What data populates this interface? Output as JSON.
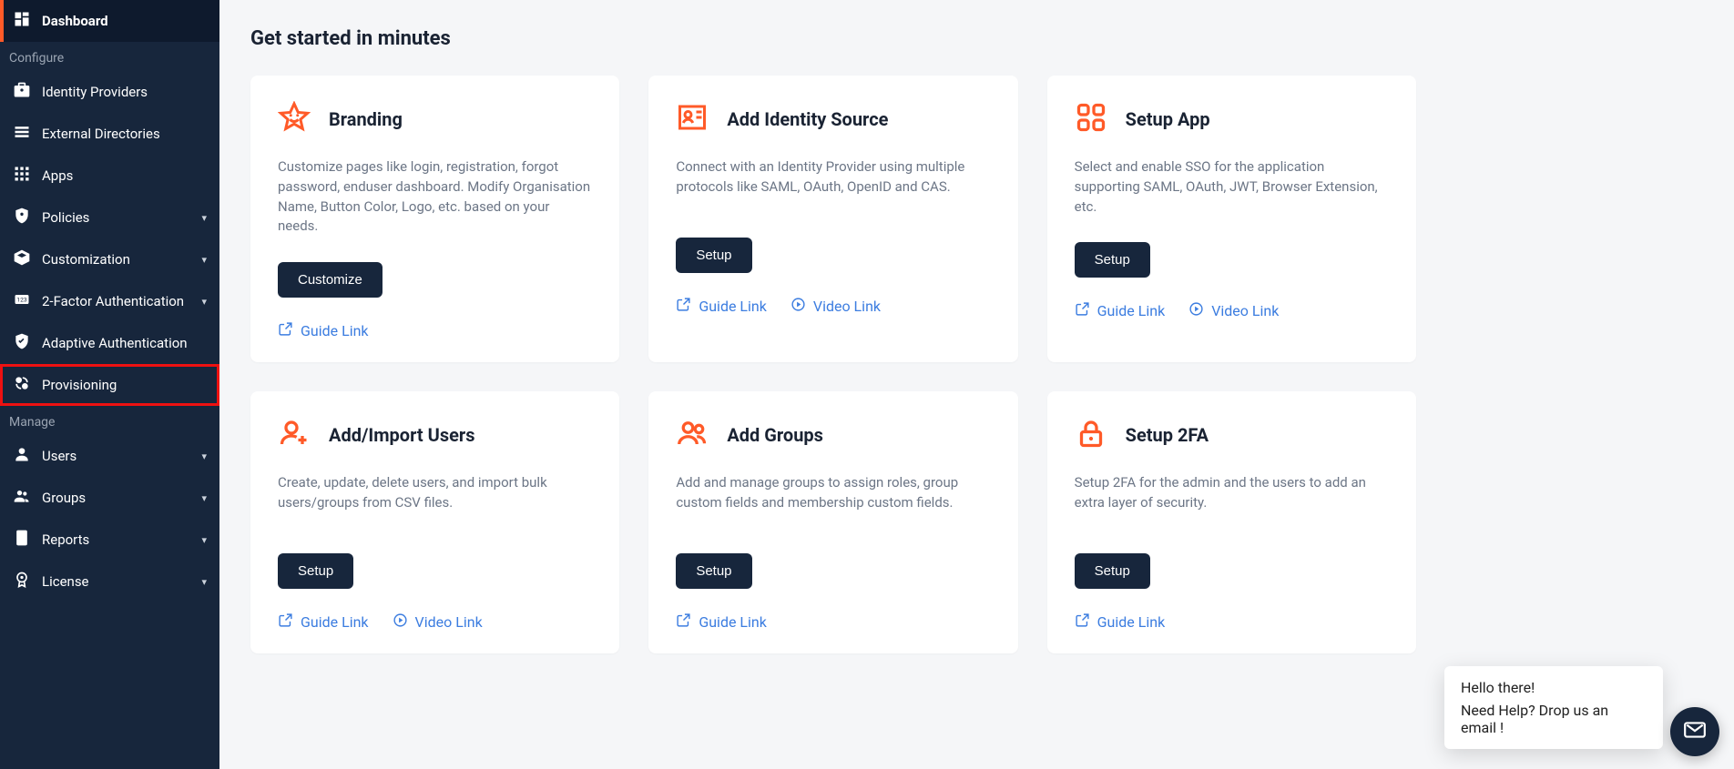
{
  "sidebar": {
    "items": [
      {
        "label": "Dashboard",
        "expandable": false,
        "active": true
      },
      {
        "section": "Configure"
      },
      {
        "label": "Identity Providers",
        "expandable": false
      },
      {
        "label": "External Directories",
        "expandable": false
      },
      {
        "label": "Apps",
        "expandable": false
      },
      {
        "label": "Policies",
        "expandable": true
      },
      {
        "label": "Customization",
        "expandable": true
      },
      {
        "label": "2-Factor Authentication",
        "expandable": true
      },
      {
        "label": "Adaptive Authentication",
        "expandable": false
      },
      {
        "label": "Provisioning",
        "expandable": false,
        "highlight": true
      },
      {
        "section": "Manage"
      },
      {
        "label": "Users",
        "expandable": true
      },
      {
        "label": "Groups",
        "expandable": true
      },
      {
        "label": "Reports",
        "expandable": true
      },
      {
        "label": "License",
        "expandable": true
      }
    ]
  },
  "page": {
    "title": "Get started in minutes"
  },
  "cards": [
    {
      "icon": "star",
      "title": "Branding",
      "desc": "Customize pages like login, registration, forgot password, enduser dashboard. Modify Organisation Name, Button Color, Logo, etc. based on your needs.",
      "button": "Customize",
      "links": [
        {
          "type": "guide",
          "label": "Guide Link"
        }
      ]
    },
    {
      "icon": "idcard",
      "title": "Add Identity Source",
      "desc": "Connect with an Identity Provider using multiple protocols like SAML, OAuth, OpenID and CAS.",
      "button": "Setup",
      "links": [
        {
          "type": "guide",
          "label": "Guide Link"
        },
        {
          "type": "video",
          "label": "Video Link"
        }
      ]
    },
    {
      "icon": "apps",
      "title": "Setup App",
      "desc": "Select and enable SSO for the application supporting SAML, OAuth, JWT, Browser Extension, etc.",
      "button": "Setup",
      "links": [
        {
          "type": "guide",
          "label": "Guide Link"
        },
        {
          "type": "video",
          "label": "Video Link"
        }
      ]
    },
    {
      "icon": "useradd",
      "title": "Add/Import Users",
      "desc": "Create, update, delete users, and import bulk users/groups from CSV files.",
      "button": "Setup",
      "links": [
        {
          "type": "guide",
          "label": "Guide Link"
        },
        {
          "type": "video",
          "label": "Video Link"
        }
      ]
    },
    {
      "icon": "group",
      "title": "Add Groups",
      "desc": "Add and manage groups to assign roles, group custom fields and membership custom fields.",
      "button": "Setup",
      "links": [
        {
          "type": "guide",
          "label": "Guide Link"
        }
      ]
    },
    {
      "icon": "lock",
      "title": "Setup 2FA",
      "desc": "Setup 2FA for the admin and the users to add an extra layer of security.",
      "button": "Setup",
      "links": [
        {
          "type": "guide",
          "label": "Guide Link"
        }
      ]
    }
  ],
  "chat": {
    "line1": "Hello there!",
    "line2": "Need Help? Drop us an email !"
  },
  "colors": {
    "accent": "#ff5a28",
    "primary": "#17263c",
    "link": "#3c7de0"
  }
}
